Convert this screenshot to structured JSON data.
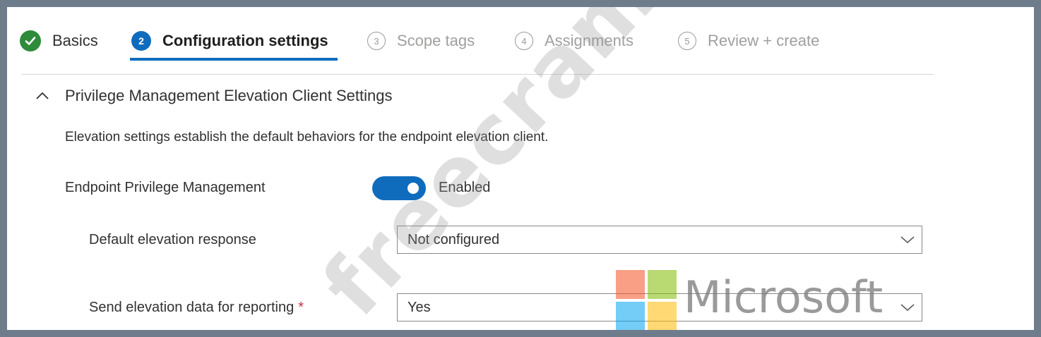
{
  "wizard": {
    "steps": [
      {
        "number": "",
        "label": "Basics",
        "state": "done"
      },
      {
        "number": "2",
        "label": "Configuration settings",
        "state": "current"
      },
      {
        "number": "3",
        "label": "Scope tags",
        "state": "pending"
      },
      {
        "number": "4",
        "label": "Assignments",
        "state": "pending"
      },
      {
        "number": "5",
        "label": "Review + create",
        "state": "pending"
      }
    ]
  },
  "section": {
    "title": "Privilege Management Elevation Client Settings",
    "description": "Elevation settings establish the default behaviors for the endpoint elevation client."
  },
  "settings": {
    "epm": {
      "label": "Endpoint Privilege Management",
      "toggle_text": "Enabled",
      "enabled": true
    },
    "default_response": {
      "label": "Default elevation response",
      "value": "Not configured"
    },
    "send_data": {
      "label": "Send elevation data for reporting",
      "required_mark": "*",
      "value": "Yes"
    }
  },
  "watermark": {
    "text": "freecram.net"
  },
  "logo": {
    "text": "Microsoft",
    "colors": [
      "#f25022",
      "#7fba00",
      "#00a4ef",
      "#ffb900"
    ]
  },
  "colors": {
    "accent": "#0f6cbd",
    "success": "#2e8b3a",
    "required": "#c4314b"
  }
}
